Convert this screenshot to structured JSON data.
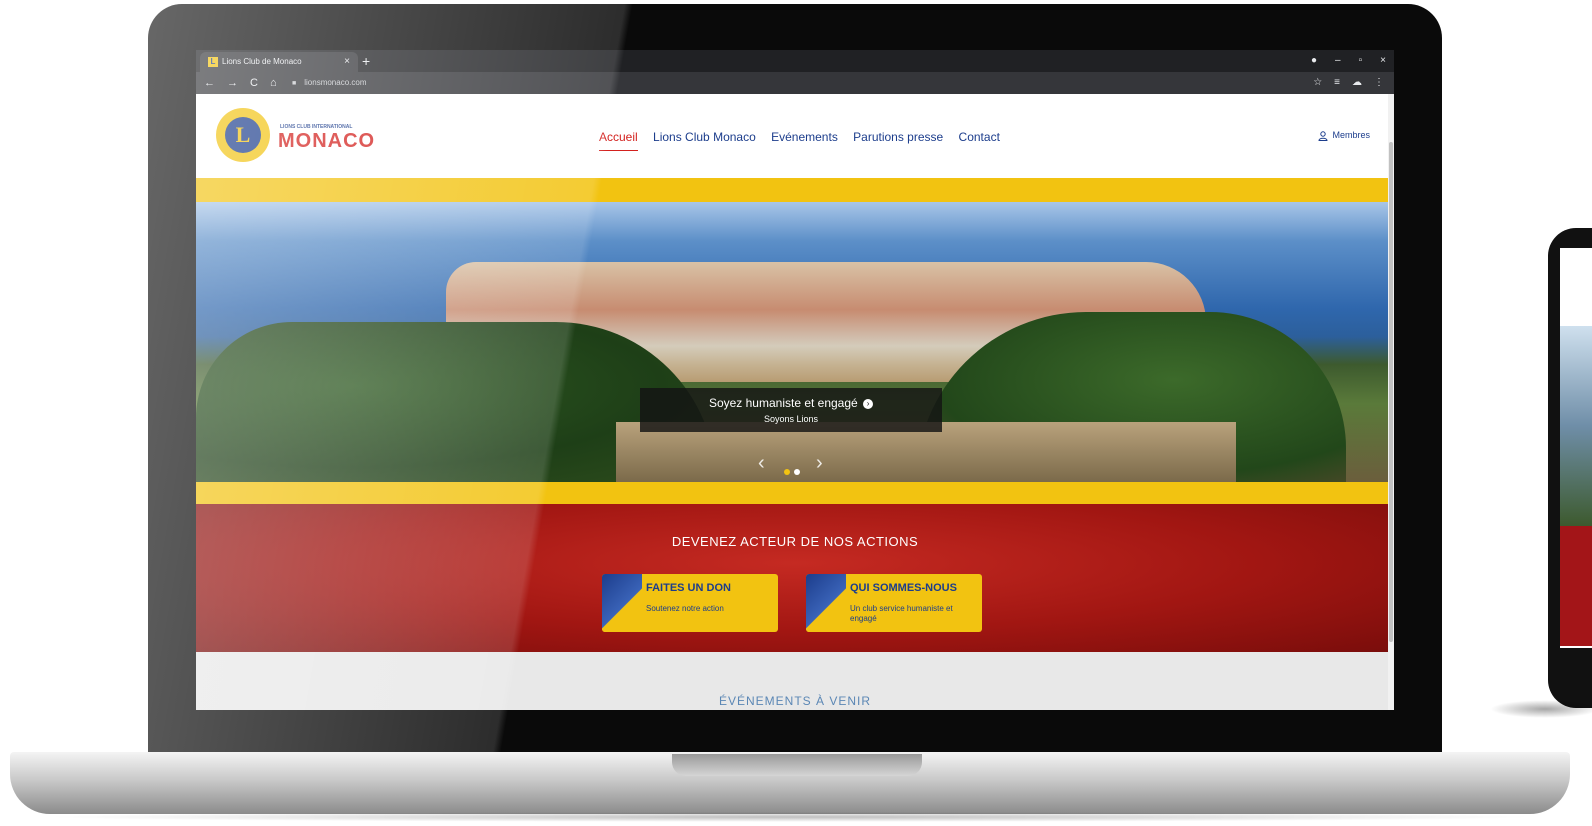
{
  "browser": {
    "tab_title": "Lions Club de Monaco",
    "tab_favicon": "L",
    "tab_close": "×",
    "new_tab": "+",
    "url": "lionsmonaco.com",
    "window_controls": [
      "●",
      "–",
      "▫",
      "×"
    ],
    "nav_buttons": [
      "←",
      "→",
      "C",
      "⌂"
    ],
    "right_icons": [
      "☆",
      "≡",
      "☁",
      "⋮"
    ]
  },
  "header": {
    "logo_small": "LIONS CLUB INTERNATIONAL",
    "logo_text": "MONACO",
    "nav": [
      "Accueil",
      "Lions Club Monaco",
      "Evénements",
      "Parutions presse",
      "Contact"
    ],
    "members_label": "Membres"
  },
  "hero": {
    "caption_title": "Soyez humaniste et engagé",
    "caption_subtitle": "Soyons Lions",
    "prev": "‹",
    "next": "›",
    "arrow_glyph": "›"
  },
  "actions": {
    "title": "DEVENEZ ACTEUR DE NOS ACTIONS",
    "cards": [
      {
        "title": "FAITES UN DON",
        "subtitle": "Soutenez notre action"
      },
      {
        "title": "QUI SOMMES-NOUS",
        "subtitle": "Un club service humaniste et engagé"
      }
    ]
  },
  "events": {
    "title": "ÉVÉNEMENTS À VENIR"
  },
  "colors": {
    "accent_yellow": "#f2c311",
    "brand_blue": "#1c3d8c",
    "brand_red": "#d3211e",
    "section_red": "#a11612"
  }
}
